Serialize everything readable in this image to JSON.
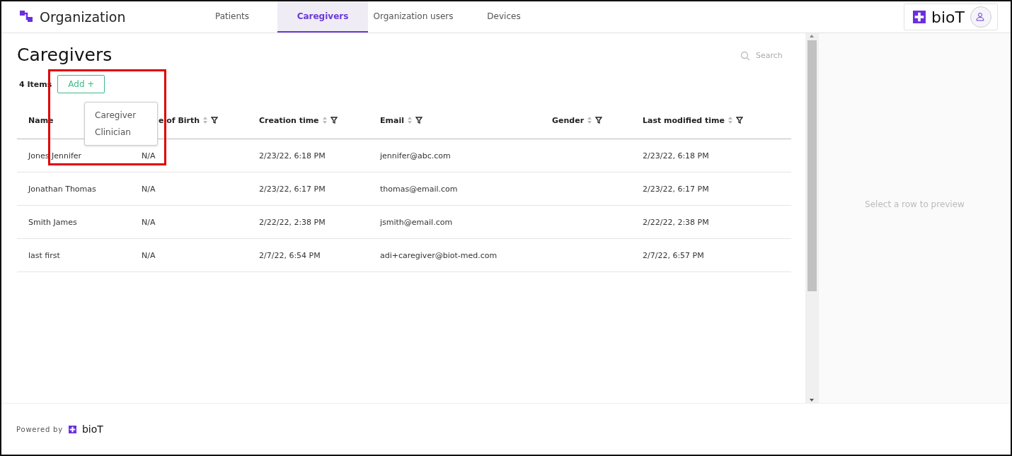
{
  "header": {
    "title": "Organization",
    "tabs": [
      {
        "label": "Patients",
        "selected": false
      },
      {
        "label": "Caregivers",
        "selected": true
      },
      {
        "label": "Organization users",
        "selected": false
      },
      {
        "label": "Devices",
        "selected": false
      }
    ],
    "brand": "bioT"
  },
  "page": {
    "title": "Caregivers",
    "count": "4 Items",
    "add_button": "Add +",
    "search": {
      "placeholder": "Search"
    },
    "add_menu": [
      "Caregiver",
      "Clinician"
    ],
    "columns": [
      {
        "label": "Name",
        "sortable": false
      },
      {
        "label": "e of Birth",
        "sortable": true
      },
      {
        "label": "Creation time",
        "sortable": true
      },
      {
        "label": "Email",
        "sortable": true
      },
      {
        "label": "Gender",
        "sortable": true
      },
      {
        "label": "Last modified time",
        "sortable": true
      }
    ],
    "rows": [
      [
        "Jones Jennifer",
        "N/A",
        "2/23/22, 6:18 PM",
        "jennifer@abc.com",
        "",
        "2/23/22, 6:18 PM"
      ],
      [
        "Jonathan Thomas",
        "N/A",
        "2/23/22, 6:17 PM",
        "thomas@email.com",
        "",
        "2/23/22, 6:17 PM"
      ],
      [
        "Smith James",
        "N/A",
        "2/22/22, 2:38 PM",
        "jsmith@email.com",
        "",
        "2/22/22, 2:38 PM"
      ],
      [
        "last first",
        "N/A",
        "2/7/22, 6:54 PM",
        "adi+caregiver@biot-med.com",
        "",
        "2/7/22, 6:57 PM"
      ]
    ]
  },
  "preview": {
    "message": "Select a row to preview"
  },
  "footer": {
    "label": "Powered by",
    "brand": "bioT"
  }
}
